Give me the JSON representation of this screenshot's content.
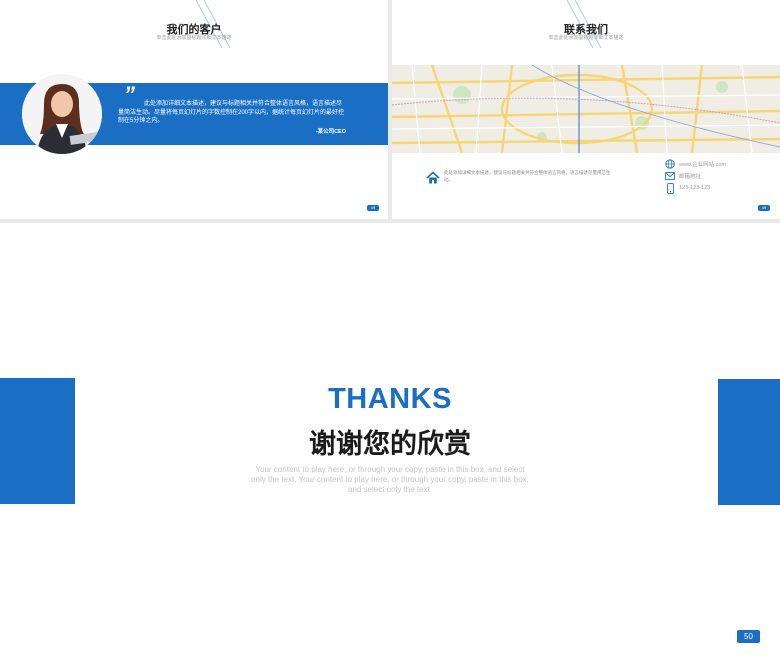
{
  "slide_clients": {
    "title": "我们的客户",
    "subtitle": "单击此处添加副标题详细文本描述",
    "quote_mark": "”",
    "quote": "此处添加详细文本描述，建议与标题相关并符合整体语言风格，语言描述尽量简洁生动。尽量将每页幻灯片的字数控制在200字以内，据统计每页幻灯片的最好控制在5分钟之内。",
    "author": "-某公司CEO",
    "page": "49"
  },
  "slide_contact": {
    "title": "联系我们",
    "subtitle": "单击此处添加副标题详细文本描述",
    "description": "此处添加详细文本描述，建议与标题相关并符合整体语言风格，语言描述尽量简洁生动。",
    "website": "www.企业网站.com",
    "email": "邮箱地址",
    "phone": "123-123-123",
    "icons": [
      "home-icon",
      "globe-icon",
      "mail-icon",
      "phone-icon"
    ],
    "page": "49"
  },
  "slide_thanks": {
    "heading_en": "THANKS",
    "heading_cn": "谢谢您的欣赏",
    "body": "Your content to play here, or through your copy, paste in this box, and select only the text. Your content to play here, or through your copy, paste in this box, and select only the text.",
    "page": "50"
  },
  "colors": {
    "accent": "#1a6fc4",
    "text_dark": "#1b1b1b",
    "text_muted": "#c4c4c4"
  }
}
